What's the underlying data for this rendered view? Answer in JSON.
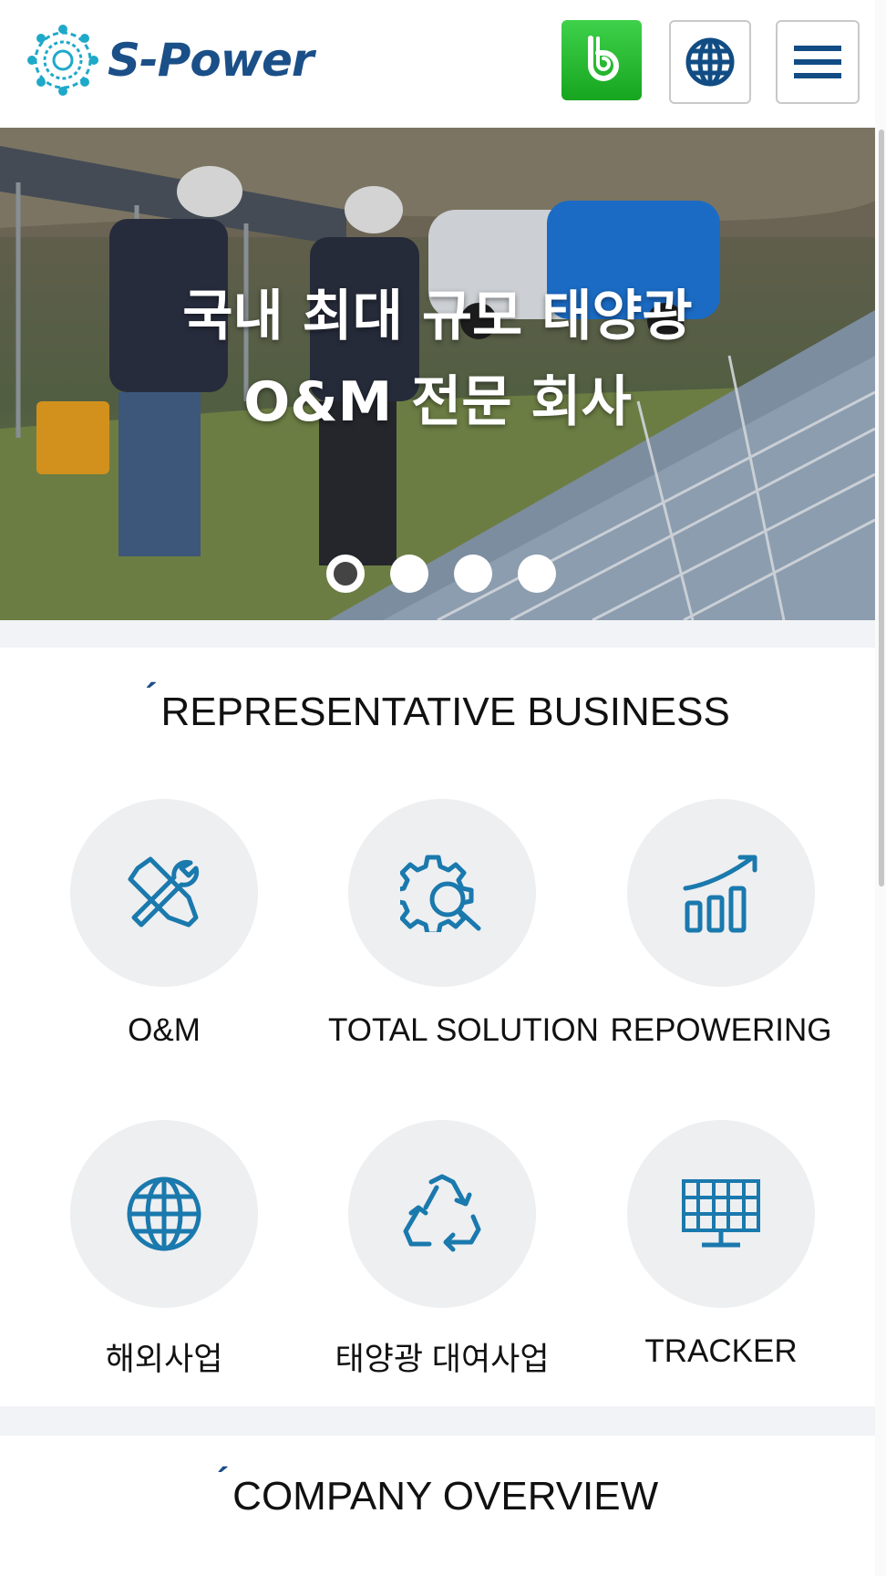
{
  "header": {
    "logo_text": "S-Power",
    "blog_icon": "blog-b-icon",
    "globe_icon": "globe-icon",
    "menu_icon": "hamburger-menu-icon",
    "brand_color": "#1b4f88",
    "blog_color": "#1fb02a"
  },
  "hero": {
    "title_line1": "국내 최대 규모 태양광",
    "title_line2": "O&M 전문 회사",
    "slides_total": 4,
    "active_slide": 1
  },
  "business": {
    "title": "REPRESENTATIVE BUSINESS",
    "items": [
      {
        "label": "O&M",
        "icon": "wrench-screwdriver-icon"
      },
      {
        "label": "TOTAL SOLUTION",
        "icon": "gear-magnifier-icon"
      },
      {
        "label": "REPOWERING",
        "icon": "growth-chart-icon"
      },
      {
        "label": "해외사업",
        "icon": "globe-icon"
      },
      {
        "label": "태양광 대여사업",
        "icon": "recycle-icon"
      },
      {
        "label": "TRACKER",
        "icon": "solar-panel-icon"
      }
    ]
  },
  "overview": {
    "title": "COMPANY OVERVIEW"
  }
}
